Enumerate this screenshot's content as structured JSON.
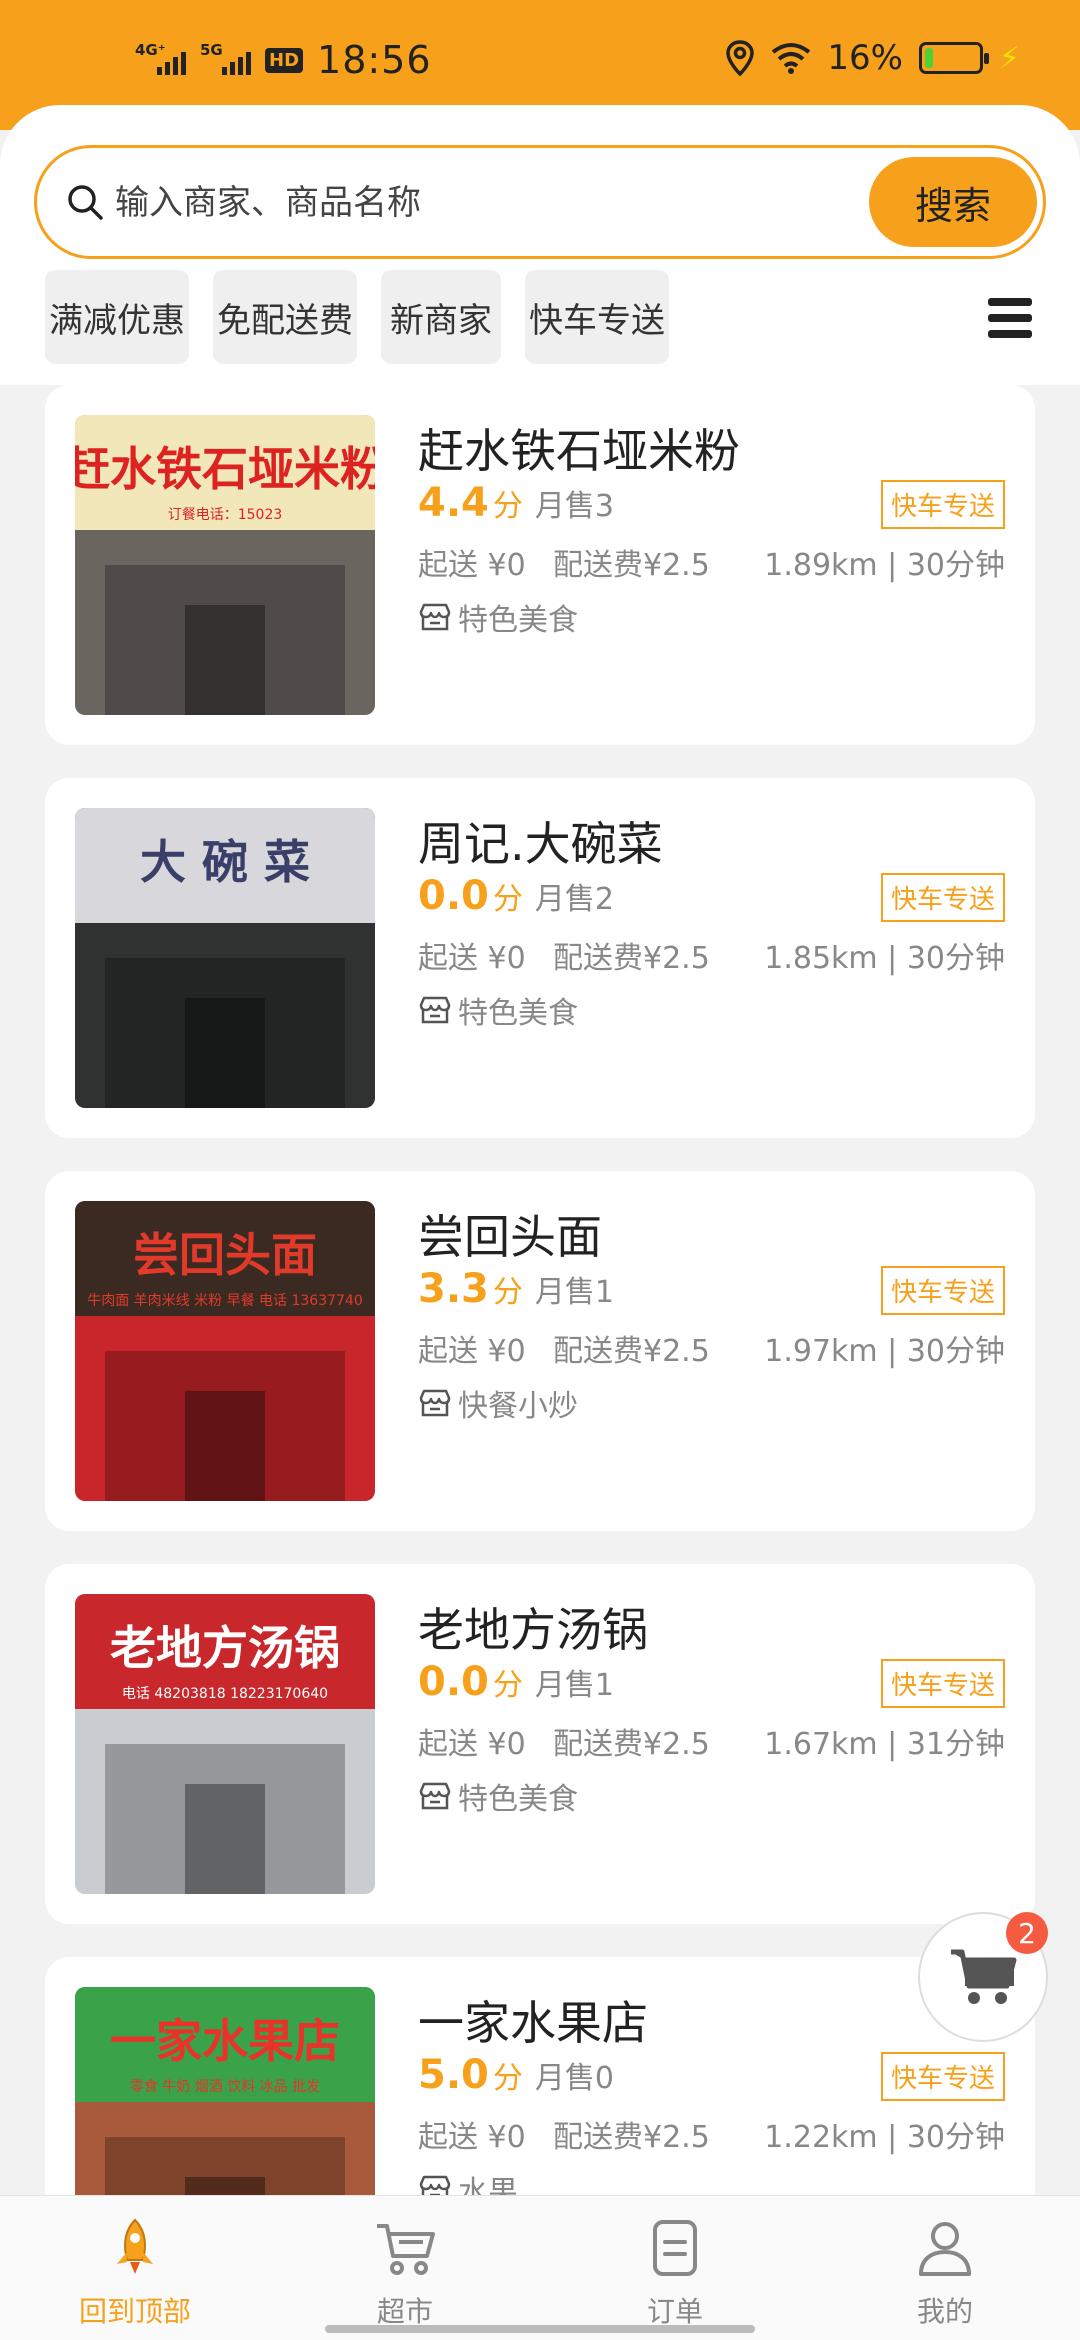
{
  "status_bar": {
    "signal1": "4G⁺",
    "signal2": "5G",
    "hd_badge": "HD",
    "time": "18:56",
    "battery_percent": "16%",
    "battery_level": 0.16
  },
  "search": {
    "placeholder": "输入商家、商品名称",
    "button_label": "搜索"
  },
  "filters": [
    "满减优惠",
    "免配送费",
    "新商家",
    "快车专送"
  ],
  "shops": [
    {
      "name": "赶水铁石垭米粉",
      "rating": "4.4",
      "rating_unit": "分",
      "sales": "月售3",
      "tag": "快车专送",
      "min_order": "起送 ¥0",
      "delivery_fee": "配送费¥2.5",
      "distance_time": "1.89km | 30分钟",
      "category": "特色美食",
      "thumb": {
        "sign_text": "赶水铁石垭米粉",
        "sign_sub": "订餐电话：15023",
        "sign_bg": "#f2e7b8",
        "sign_fg": "#d22",
        "lower_bg": "#6b6560"
      }
    },
    {
      "name": "周记.大碗菜",
      "rating": "0.0",
      "rating_unit": "分",
      "sales": "月售2",
      "tag": "快车专送",
      "min_order": "起送 ¥0",
      "delivery_fee": "配送费¥2.5",
      "distance_time": "1.85km | 30分钟",
      "category": "特色美食",
      "thumb": {
        "sign_text": "大 碗 菜",
        "sign_sub": "",
        "sign_bg": "#d8d8dc",
        "sign_fg": "#3a3f6a",
        "lower_bg": "#2f3230"
      }
    },
    {
      "name": "尝回头面",
      "rating": "3.3",
      "rating_unit": "分",
      "sales": "月售1",
      "tag": "快车专送",
      "min_order": "起送 ¥0",
      "delivery_fee": "配送费¥2.5",
      "distance_time": "1.97km | 30分钟",
      "category": "快餐小炒",
      "thumb": {
        "sign_text": "尝回头面",
        "sign_sub": "牛肉面 羊肉米线 米粉 早餐 电话 13637740",
        "sign_bg": "#3a2a22",
        "sign_fg": "#e23a2a",
        "lower_bg": "#c8262a"
      }
    },
    {
      "name": "老地方汤锅",
      "rating": "0.0",
      "rating_unit": "分",
      "sales": "月售1",
      "tag": "快车专送",
      "min_order": "起送 ¥0",
      "delivery_fee": "配送费¥2.5",
      "distance_time": "1.67km | 31分钟",
      "category": "特色美食",
      "thumb": {
        "sign_text": "老地方汤锅",
        "sign_sub": "电话 48203818  18223170640",
        "sign_bg": "#c8282c",
        "sign_fg": "#ffffff",
        "lower_bg": "#c9ccd0"
      }
    },
    {
      "name": "一家水果店",
      "rating": "5.0",
      "rating_unit": "分",
      "sales": "月售0",
      "tag": "快车专送",
      "min_order": "起送 ¥0",
      "delivery_fee": "配送费¥2.5",
      "distance_time": "1.22km | 30分钟",
      "category": "水果",
      "thumb": {
        "sign_text": "一家水果店",
        "sign_sub": "零食 牛奶 烟酒 饮料 冰品 批发",
        "sign_bg": "#3aa34a",
        "sign_fg": "#e8322a",
        "lower_bg": "#a85a3a"
      }
    }
  ],
  "cart": {
    "badge_count": "2"
  },
  "bottom_nav": [
    {
      "label": "回到顶部",
      "icon": "rocket-icon",
      "active": true
    },
    {
      "label": "超市",
      "icon": "cart-icon",
      "active": false
    },
    {
      "label": "订单",
      "icon": "order-icon",
      "active": false
    },
    {
      "label": "我的",
      "icon": "user-icon",
      "active": false
    }
  ],
  "colors": {
    "accent": "#f7a01c",
    "badge": "#f55b41",
    "background": "#f2f2f2"
  }
}
